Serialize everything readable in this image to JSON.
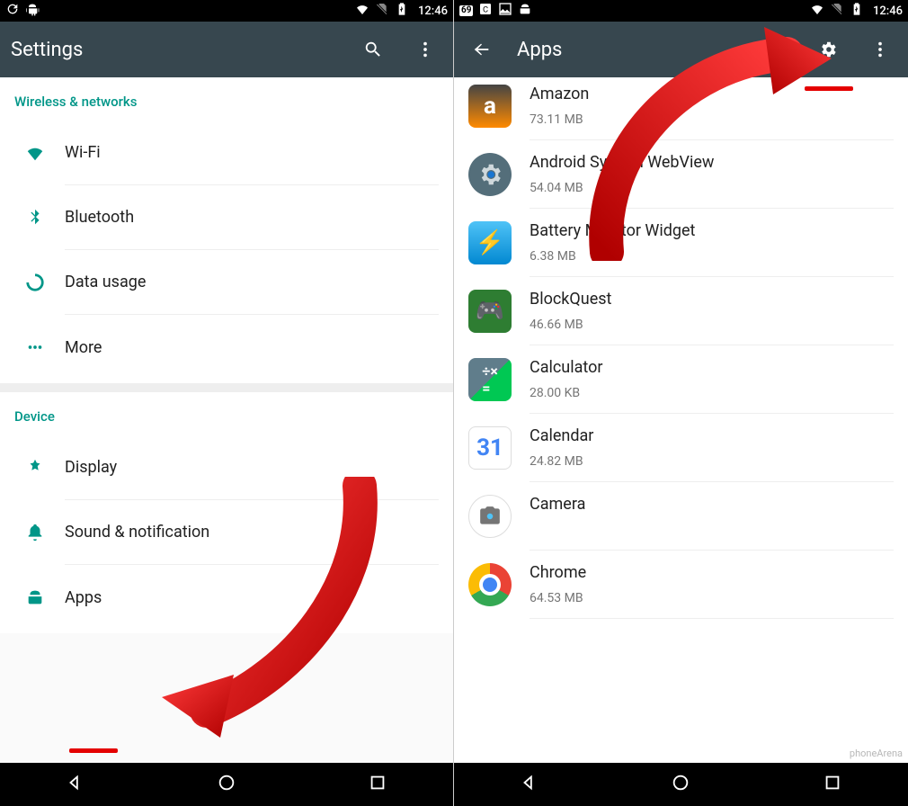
{
  "statusbar": {
    "clock": "12:46"
  },
  "settings": {
    "title": "Settings",
    "section_wireless": "Wireless & networks",
    "wifi": "Wi-Fi",
    "bluetooth": "Bluetooth",
    "data": "Data usage",
    "more": "More",
    "section_device": "Device",
    "display": "Display",
    "sound": "Sound & notification",
    "apps": "Apps"
  },
  "appsScreen": {
    "title": "Apps",
    "items": [
      {
        "name": "Amazon",
        "size": "73.11 MB"
      },
      {
        "name": "Android System WebView",
        "size": "54.04 MB"
      },
      {
        "name": "Battery Monitor Widget",
        "size": "6.38 MB"
      },
      {
        "name": "BlockQuest",
        "size": "46.66 MB"
      },
      {
        "name": "Calculator",
        "size": "28.00 KB"
      },
      {
        "name": "Calendar",
        "size": "24.82 MB"
      },
      {
        "name": "Camera",
        "size": ""
      },
      {
        "name": "Chrome",
        "size": "64.53 MB"
      }
    ]
  },
  "watermark": "phoneArena"
}
